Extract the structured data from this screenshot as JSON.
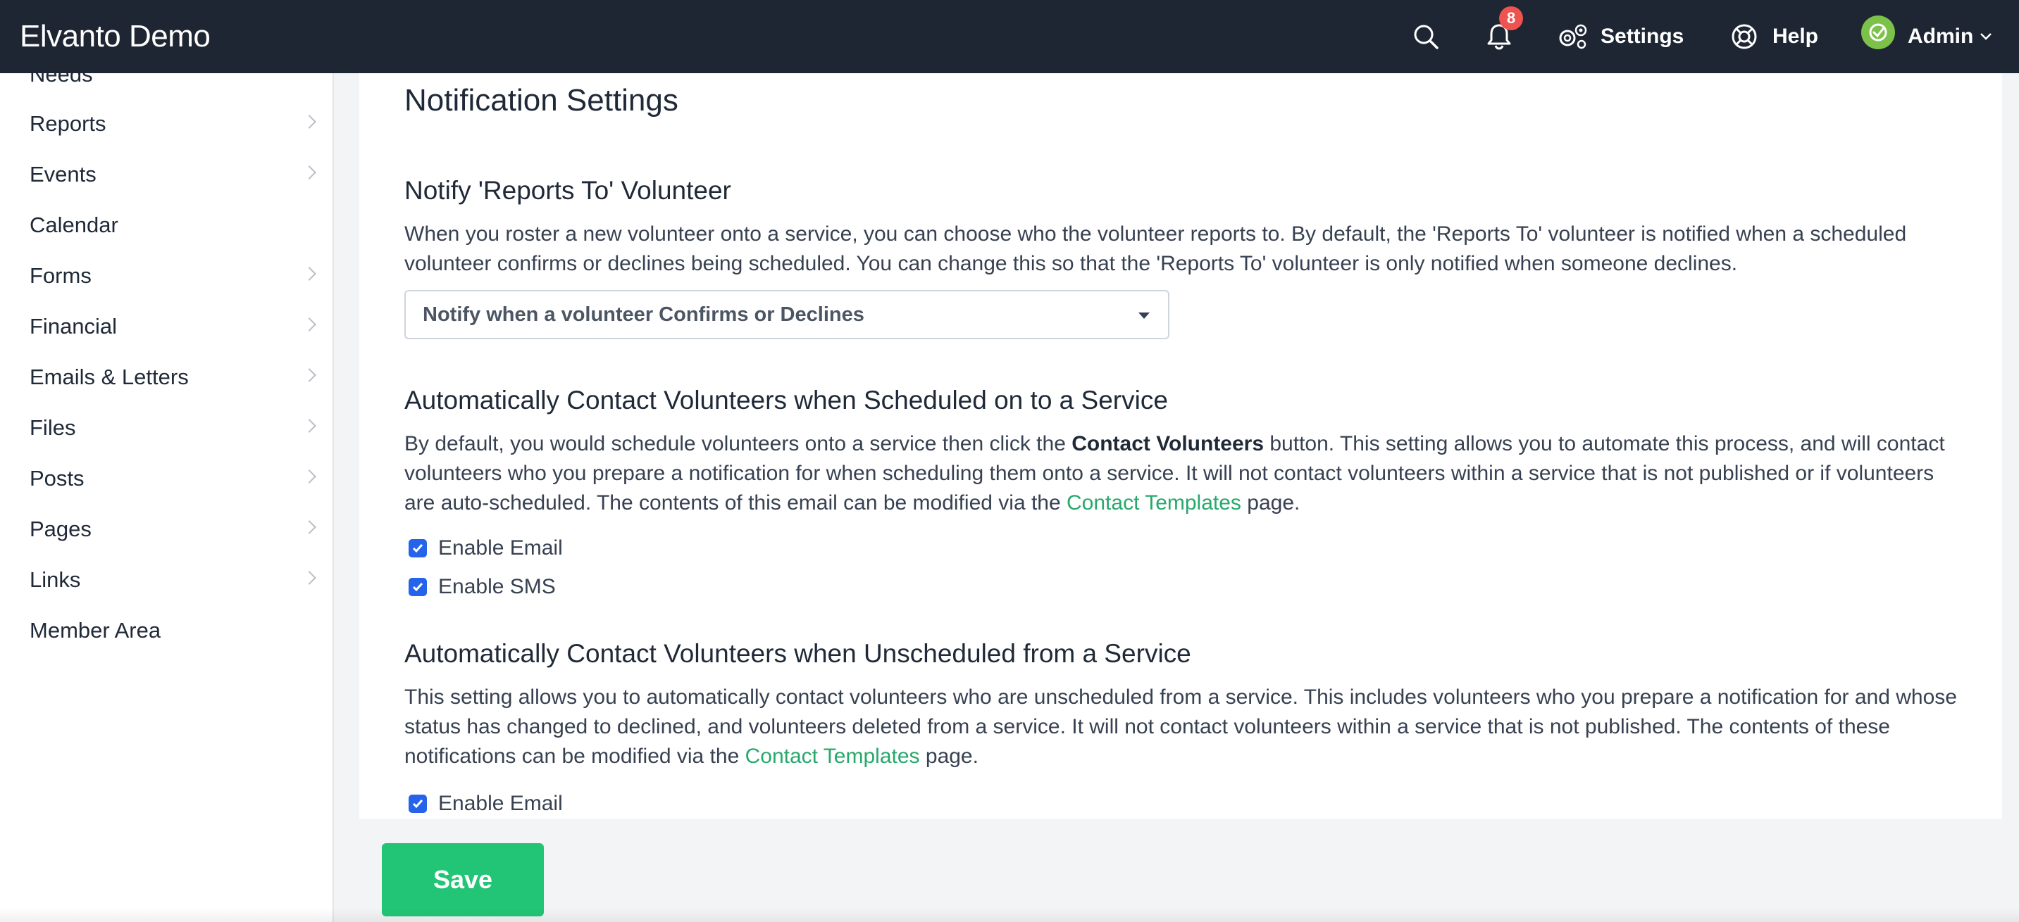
{
  "app": {
    "title": "Elvanto Demo"
  },
  "header": {
    "notifications_count": "8",
    "settings_label": "Settings",
    "help_label": "Help",
    "user_label": "Admin"
  },
  "sidebar": {
    "items": [
      {
        "label": "Needs",
        "has_children": true
      },
      {
        "label": "Reports",
        "has_children": true
      },
      {
        "label": "Events",
        "has_children": true
      },
      {
        "label": "Calendar",
        "has_children": false
      },
      {
        "label": "Forms",
        "has_children": true
      },
      {
        "label": "Financial",
        "has_children": true
      },
      {
        "label": "Emails & Letters",
        "has_children": true
      },
      {
        "label": "Files",
        "has_children": true
      },
      {
        "label": "Posts",
        "has_children": true
      },
      {
        "label": "Pages",
        "has_children": true
      },
      {
        "label": "Links",
        "has_children": true
      },
      {
        "label": "Member Area",
        "has_children": false
      }
    ]
  },
  "main": {
    "page_title": "Notification Settings",
    "sections": [
      {
        "title": "Notify 'Reports To' Volunteer",
        "description": "When you roster a new volunteer onto a service, you can choose who the volunteer reports to. By default, the 'Reports To' volunteer is notified when a scheduled volunteer confirms or declines being scheduled. You can change this so that the 'Reports To' volunteer is only notified when someone declines.",
        "select_value": "Notify when a volunteer Confirms or Declines"
      },
      {
        "title": "Automatically Contact Volunteers when Scheduled on to a Service",
        "description_pre": "By default, you would schedule volunteers onto a service then click the ",
        "description_bold": "Contact Volunteers",
        "description_mid": " button. This setting allows you to automate this process, and will contact volunteers who you prepare a notification for when scheduling them onto a service. It will not contact volunteers within a service that is not published or if volunteers are auto-scheduled. The contents of this email can be modified via the ",
        "link_text": "Contact Templates",
        "description_post": " page.",
        "checkboxes": [
          {
            "label": "Enable Email",
            "checked": true
          },
          {
            "label": "Enable SMS",
            "checked": true
          }
        ]
      },
      {
        "title": "Automatically Contact Volunteers when Unscheduled from a Service",
        "description_pre": "This setting allows you to automatically contact volunteers who are unscheduled from a service. This includes volunteers who you prepare a notification for and whose status has changed to declined, and volunteers deleted from a service. It will not contact volunteers within a service that is not published. The contents of these notifications can be modified via the ",
        "link_text": "Contact Templates",
        "description_post": " page.",
        "checkboxes": [
          {
            "label": "Enable Email",
            "checked": true
          }
        ]
      }
    ]
  },
  "footer": {
    "save_label": "Save"
  },
  "colors": {
    "topbar": "#1f2633",
    "accent_green": "#22c576",
    "link_green": "#28a86b",
    "badge_red": "#ef5350",
    "checkbox_blue": "#2563eb"
  }
}
